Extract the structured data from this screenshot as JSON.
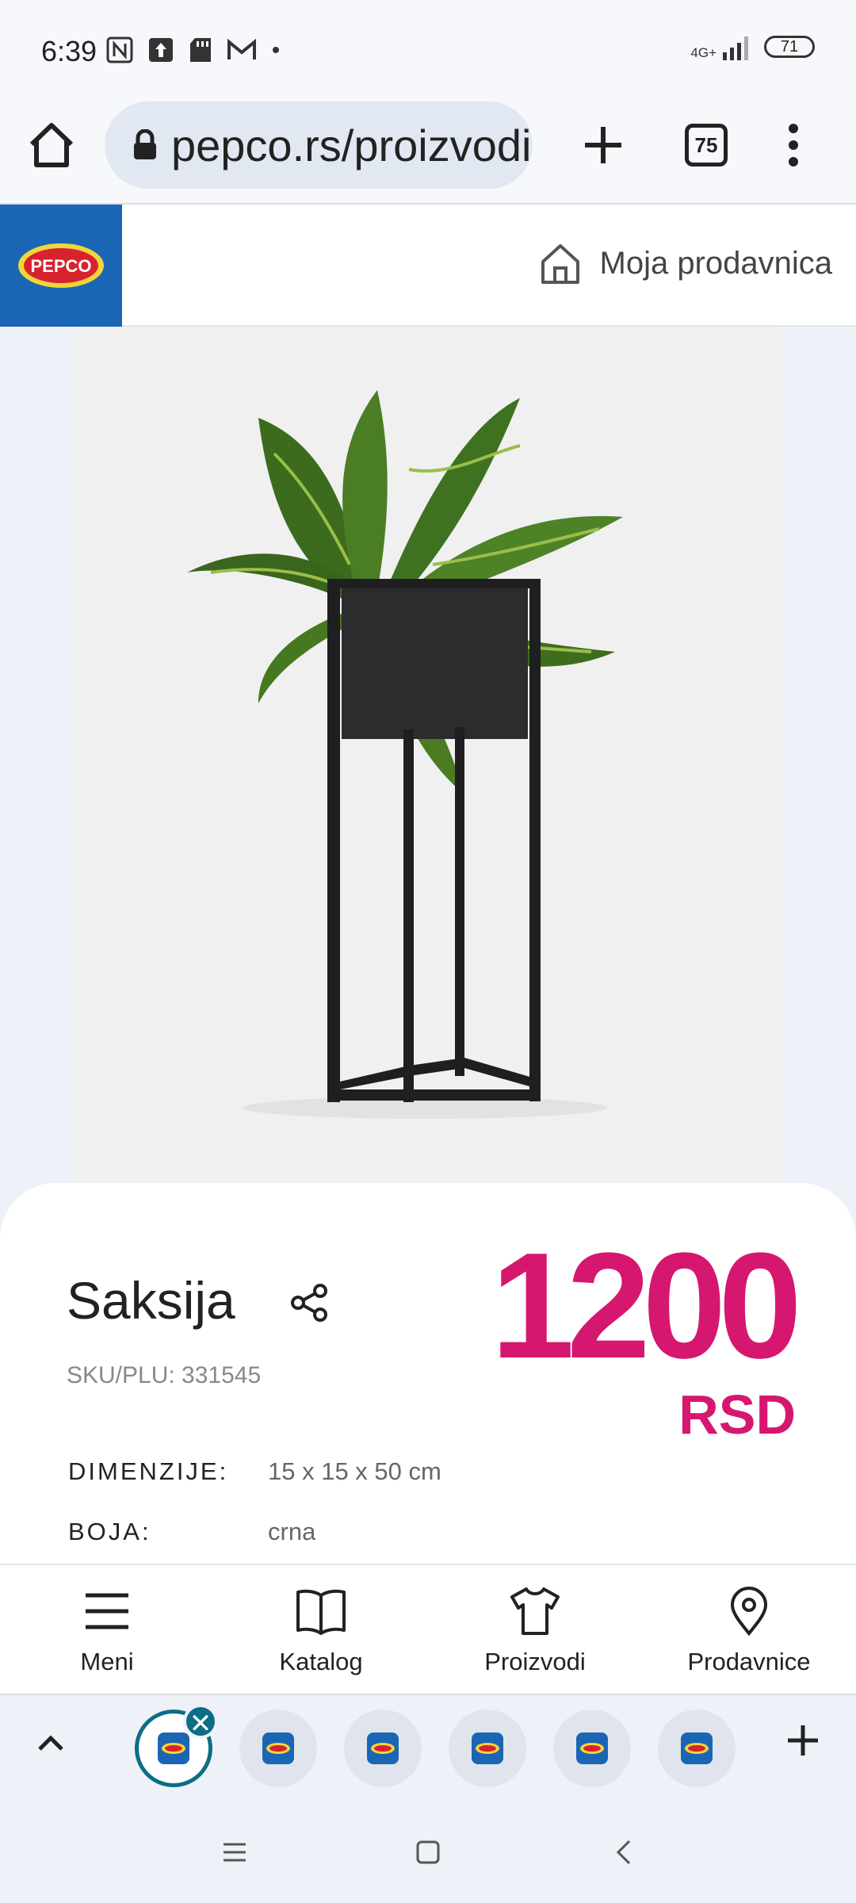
{
  "status_bar": {
    "time": "6:39",
    "network": "4G+",
    "battery": "71",
    "icons": [
      "nfc-icon",
      "upload-icon",
      "sd-card-icon",
      "gmail-icon",
      "dot-icon"
    ]
  },
  "browser": {
    "url": "pepco.rs/proizvodi",
    "tab_count": "75",
    "icons": [
      "home-icon",
      "lock-icon",
      "plus-icon",
      "menu-dots-icon"
    ]
  },
  "site_header": {
    "logo_text": "PEPCO",
    "store_label": "Moja prodavnica"
  },
  "product": {
    "name": "Saksija",
    "sku": "SKU/PLU: 331545",
    "price": "1200",
    "currency": "RSD",
    "attributes": [
      {
        "label": "DIMENZIJE:",
        "value": "15 x 15 x 50 cm"
      },
      {
        "label": "BOJA:",
        "value": "crna"
      }
    ]
  },
  "site_nav": {
    "items": [
      {
        "label": "Meni",
        "icon": "hamburger-icon"
      },
      {
        "label": "Katalog",
        "icon": "book-icon"
      },
      {
        "label": "Proizvodi",
        "icon": "tshirt-icon"
      },
      {
        "label": "Prodavnice",
        "icon": "location-pin-icon"
      }
    ]
  },
  "tab_strip": {
    "close_glyph": "✕"
  },
  "colors": {
    "brand_blue": "#1b65b5",
    "price_pink": "#d6176f",
    "active_tab": "#0b6e84"
  }
}
